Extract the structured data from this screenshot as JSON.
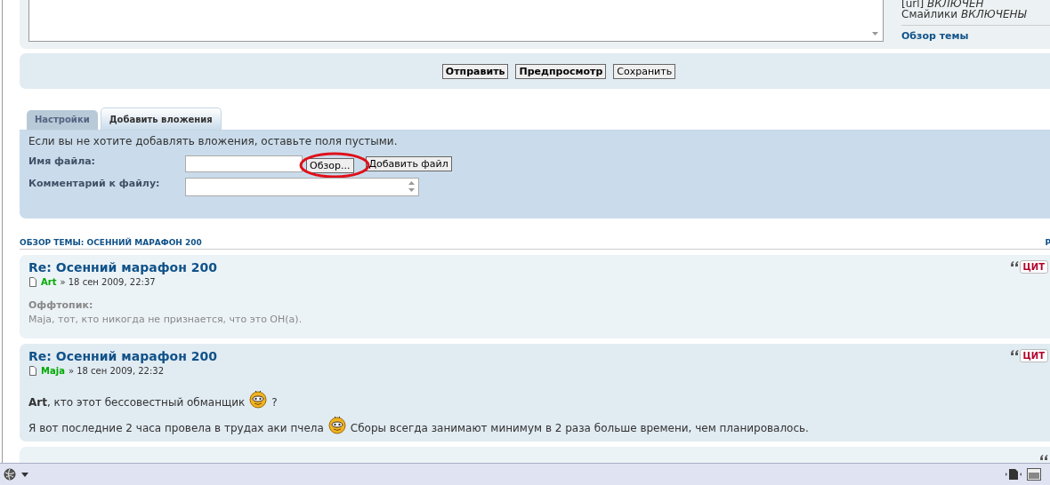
{
  "editor": {
    "options": [
      "[url] *ВКЛЮЧЕН*",
      "Смайлики *ВКЛЮЧЕНЫ*"
    ],
    "topic_link": "Обзор темы"
  },
  "submit_buttons": [
    {
      "label": "Отправить",
      "kind": "primary"
    },
    {
      "label": "Предпросмотр",
      "kind": "primary"
    },
    {
      "label": "Сохранить",
      "kind": "secondary"
    }
  ],
  "tabs": [
    {
      "label": "Настройки",
      "selected": false
    },
    {
      "label": "Добавить вложения",
      "selected": true
    }
  ],
  "attachments": {
    "hint": "Если вы не хотите добавлять вложения, оставьте поля пустыми.",
    "file_label": "Имя файла:",
    "browse_button": "Обзор...",
    "add_button": "Добавить файл",
    "comment_label": "Комментарий к файлу:",
    "browse_highlighted": true
  },
  "topic_review": {
    "heading": "ОБЗОР ТЕМЫ: ОСЕННИЙ МАРАФОН 200",
    "right_link": "Р"
  },
  "posts": [
    {
      "title": "Re: Осенний марафон 200",
      "author": "Art",
      "date": "» 18 сен 2009, 22:37",
      "quote_button": "ЦИТ",
      "body": [
        {
          "kind": "offtopic",
          "label": "Оффтопик:",
          "text": "Maja, тот, кто никогда не признается, что это ОН(а)."
        }
      ]
    },
    {
      "title": "Re: Осенний марафон 200",
      "author": "Maja",
      "date": "» 18 сен 2009, 22:32",
      "quote_button": "ЦИТ",
      "body": [
        {
          "kind": "text",
          "parts": [
            {
              "kind": "text",
              "text": "**Art**, кто этот бессовестный обманщик"
            },
            {
              "kind": "smiley"
            },
            {
              "kind": "text",
              "text": "?"
            }
          ]
        },
        {
          "kind": "text",
          "parts": [
            {
              "kind": "text",
              "text": "Я вот последние 2 часа провела в трудах аки пчела"
            },
            {
              "kind": "smiley"
            },
            {
              "kind": "text",
              "text": "Сборы всегда занимают минимум в 2 раза больше времени, чем планировалось."
            }
          ]
        }
      ]
    },
    {
      "kind": "cut_off"
    }
  ]
}
